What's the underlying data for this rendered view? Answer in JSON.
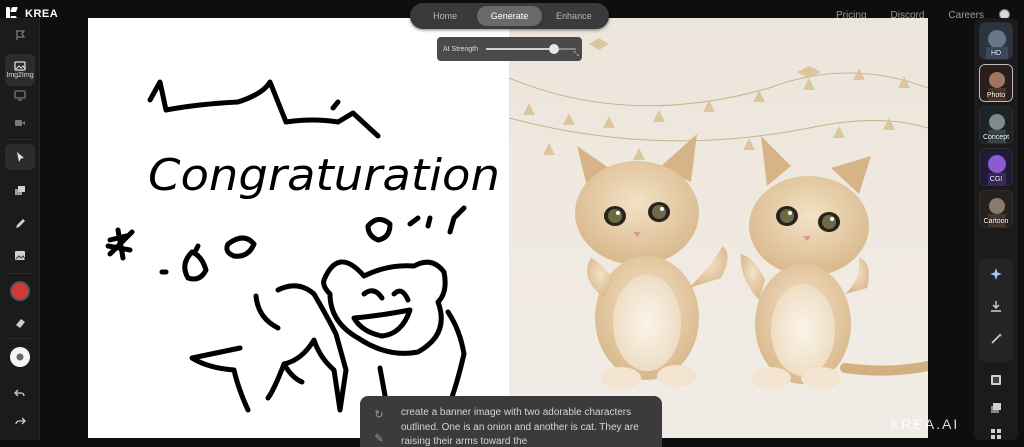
{
  "app": {
    "name": "KREA",
    "watermark": "KREA.AI"
  },
  "nav": {
    "links": [
      "Pricing",
      "Discord",
      "Careers"
    ]
  },
  "modes": {
    "tabs": [
      "Home",
      "Generate",
      "Enhance"
    ],
    "active": "Generate"
  },
  "ai_strength": {
    "label": "AI Strength",
    "value": 0.75
  },
  "left_toolbar": {
    "active_tool_label": "Img2Img",
    "brush_color": "#d23a3a"
  },
  "canvas": {
    "drawing_text": "Congraturation"
  },
  "prompt": {
    "text": "create a banner image with two adorable characters outlined. One is an onion and another is cat. They are raising their arms toward the"
  },
  "styles": [
    {
      "name": "HD",
      "selected": false
    },
    {
      "name": "Photo",
      "selected": true
    },
    {
      "name": "Concept",
      "selected": false
    },
    {
      "name": "CGI",
      "selected": false
    },
    {
      "name": "Cartoon",
      "selected": false
    }
  ],
  "colors": {
    "accent_active": "#6a6a6a",
    "brush": "#d23a3a"
  }
}
